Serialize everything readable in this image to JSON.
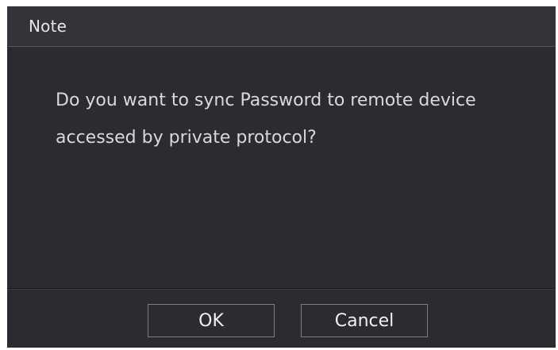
{
  "dialog": {
    "title": "Note",
    "message": "Do you want to sync Password to remote device accessed by private protocol?",
    "ok_label": "OK",
    "cancel_label": "Cancel"
  }
}
